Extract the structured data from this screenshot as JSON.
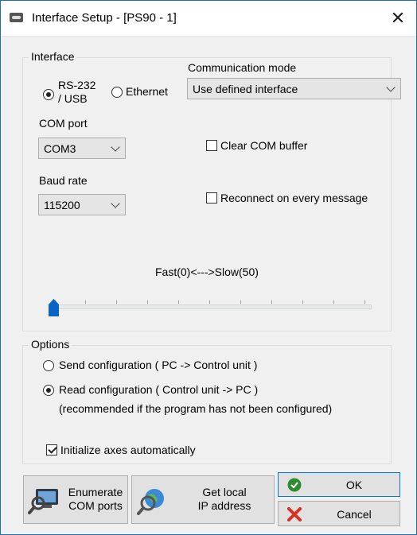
{
  "window": {
    "title": "Interface Setup - [PS90 - 1]",
    "close_glyph": "✕"
  },
  "interface": {
    "group_title": "Interface",
    "radio_rs232_line1": "RS-232",
    "radio_rs232_line2": "/ USB",
    "radio_rs232_checked": true,
    "radio_ethernet": "Ethernet",
    "radio_ethernet_checked": false,
    "comm_mode_label": "Communication mode",
    "comm_mode_value": "Use defined interface",
    "com_port_label": "COM port",
    "com_port_value": "COM3",
    "baud_rate_label": "Baud rate",
    "baud_rate_value": "115200",
    "clear_buffer_label": "Clear COM buffer",
    "clear_buffer_checked": false,
    "reconnect_label": "Reconnect on every message",
    "reconnect_checked": false,
    "speed_label": "Fast(0)<--->Slow(50)",
    "speed_value": 0,
    "speed_min": 0,
    "speed_max": 50
  },
  "options": {
    "group_title": "Options",
    "send_config": "Send configuration ( PC -> Control unit )",
    "send_config_checked": false,
    "read_config": "Read configuration ( Control unit -> PC )",
    "read_config_checked": true,
    "read_config_note": "(recommended if the program has not been configured)",
    "init_axes": "Initialize axes automatically",
    "init_axes_checked": true
  },
  "buttons": {
    "enumerate_line1": "Enumerate",
    "enumerate_line2": "COM ports",
    "get_ip_line1": "Get local",
    "get_ip_line2": "IP address",
    "ok": "OK",
    "cancel": "Cancel"
  },
  "colors": {
    "ok_icon": "#2e8b2e",
    "cancel_icon": "#d93025",
    "slider_thumb": "#0a64c8"
  }
}
